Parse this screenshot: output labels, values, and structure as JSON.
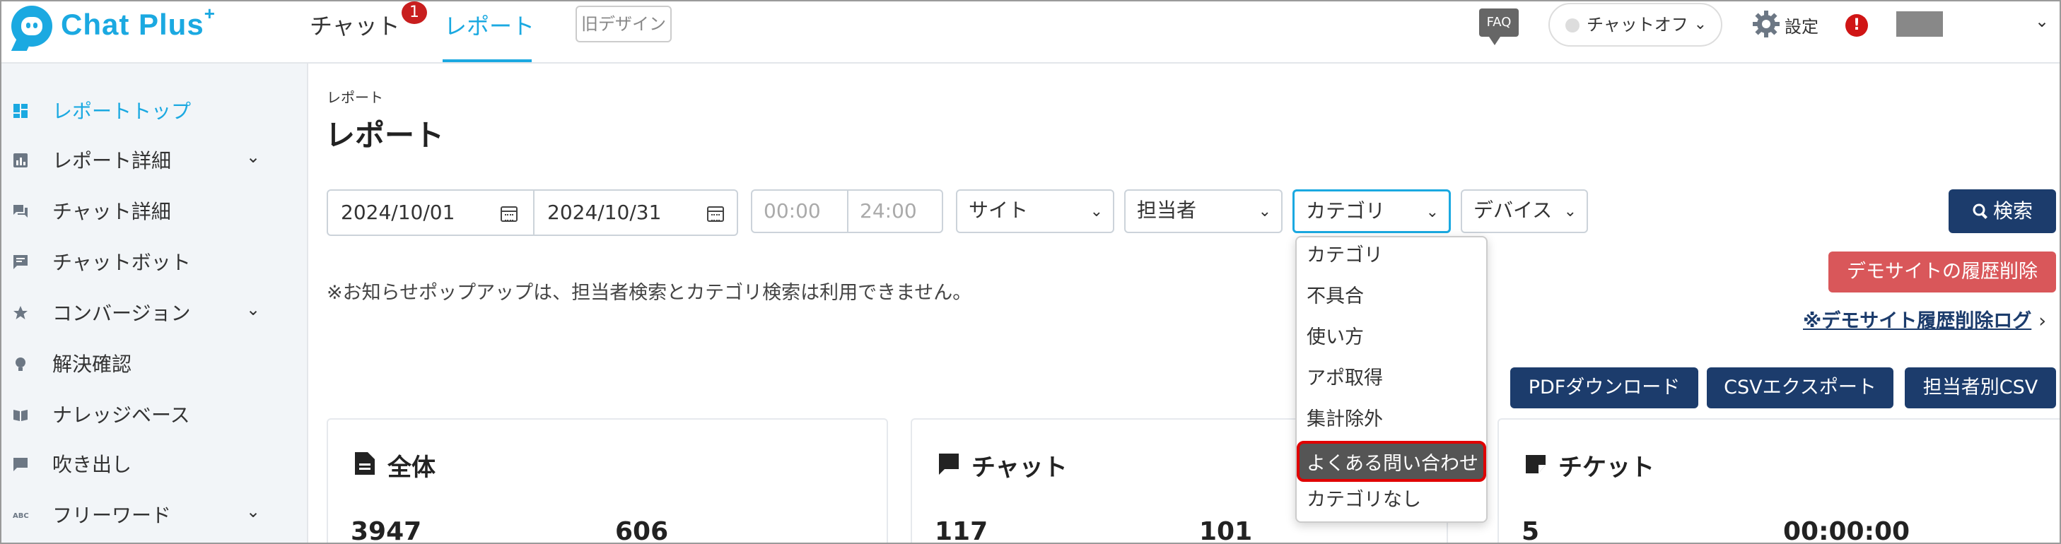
{
  "header": {
    "logo_text": "Chat Plus",
    "logo_plus": "+",
    "nav": [
      {
        "label": "チャット",
        "badge": "1"
      },
      {
        "label": "レポート"
      }
    ],
    "old_design": "旧デザイン",
    "faq": "FAQ",
    "chat_status": "チャットオフ",
    "settings": "設定",
    "alert": "!"
  },
  "sidebar": {
    "items": [
      {
        "label": "レポートトップ",
        "icon": "dashboard-icon",
        "expandable": false,
        "active": true
      },
      {
        "label": "レポート詳細",
        "icon": "report-icon",
        "expandable": true
      },
      {
        "label": "チャット詳細",
        "icon": "chat-icon",
        "expandable": false
      },
      {
        "label": "チャットボット",
        "icon": "bot-icon",
        "expandable": false
      },
      {
        "label": "コンバージョン",
        "icon": "star-icon",
        "expandable": true
      },
      {
        "label": "解決確認",
        "icon": "bulb-icon",
        "expandable": false
      },
      {
        "label": "ナレッジベース",
        "icon": "book-icon",
        "expandable": false
      },
      {
        "label": "吹き出し",
        "icon": "speech-bubble-icon",
        "expandable": false
      },
      {
        "label": "フリーワード",
        "icon": "abc-icon",
        "icon_text": "ABC",
        "expandable": true
      }
    ]
  },
  "main": {
    "breadcrumb": "レポート",
    "title": "レポート",
    "filters": {
      "date_from": "2024/10/01",
      "date_to": "2024/10/31",
      "time_from_placeholder": "00:00",
      "time_to_placeholder": "24:00",
      "site": "サイト",
      "agent": "担当者",
      "category": "カテゴリ",
      "device": "デバイス",
      "search": "検索"
    },
    "notice": "※お知らせポップアップは、担当者検索とカテゴリ検索は利用できません。",
    "demo_delete": "デモサイトの履歴削除",
    "demo_delete_log": "※デモサイト履歴削除ログ",
    "exports": {
      "pdf": "PDFダウンロード",
      "csv": "CSVエクスポート",
      "agent_csv": "担当者別CSV"
    },
    "cards": [
      {
        "title": "全体",
        "values": [
          "3947",
          "606"
        ]
      },
      {
        "title": "チャット",
        "values": [
          "117",
          "101"
        ]
      },
      {
        "title": "チケット",
        "values": [
          "5",
          "00:00:00"
        ]
      }
    ]
  },
  "category_dropdown": {
    "options": [
      "カテゴリ",
      "不具合",
      "使い方",
      "アポ取得",
      "集計除外",
      "よくある問い合わせ",
      "カテゴリなし"
    ],
    "highlighted": "よくある問い合わせ"
  },
  "colors": {
    "accent": "#1ba9e1",
    "navy": "#1c3c6c",
    "danger": "#d9575a",
    "highlight_border": "#e00000"
  }
}
